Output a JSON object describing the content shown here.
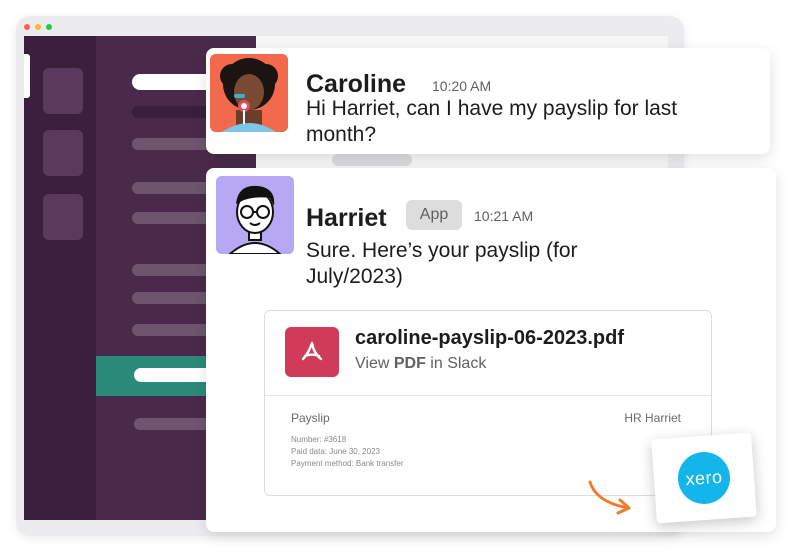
{
  "colors": {
    "accent_active": "#2b8a7a",
    "workspace_rail": "#3c1f3d",
    "sidebar": "#4a2a4b",
    "pdf_red": "#d13b5a",
    "xero_blue": "#13b5ea",
    "arrow_orange": "#f07b2b"
  },
  "messages": [
    {
      "sender": "Caroline",
      "time": "10:20 AM",
      "text": "Hi Harriet, can I have my payslip for last month?",
      "avatar_icon": "caroline-avatar"
    },
    {
      "sender": "Harriet",
      "badge": "App",
      "time": "10:21 AM",
      "text": "Sure. Here’s your payslip (for July/2023)",
      "avatar_icon": "harriet-avatar"
    }
  ],
  "attachment": {
    "file_name": "caroline-payslip-06-2023.pdf",
    "view_prefix": "View ",
    "view_format": "PDF",
    "view_suffix": " in Slack",
    "icon": "pdf-icon",
    "preview": {
      "title": "Payslip",
      "sender": "HR Harriet",
      "lines": [
        "Number: #3618",
        "Paid data: June 30, 2023",
        "Payment method: Bank transfer"
      ]
    }
  },
  "xero": {
    "logo_text": "xero",
    "icon": "xero-logo"
  }
}
